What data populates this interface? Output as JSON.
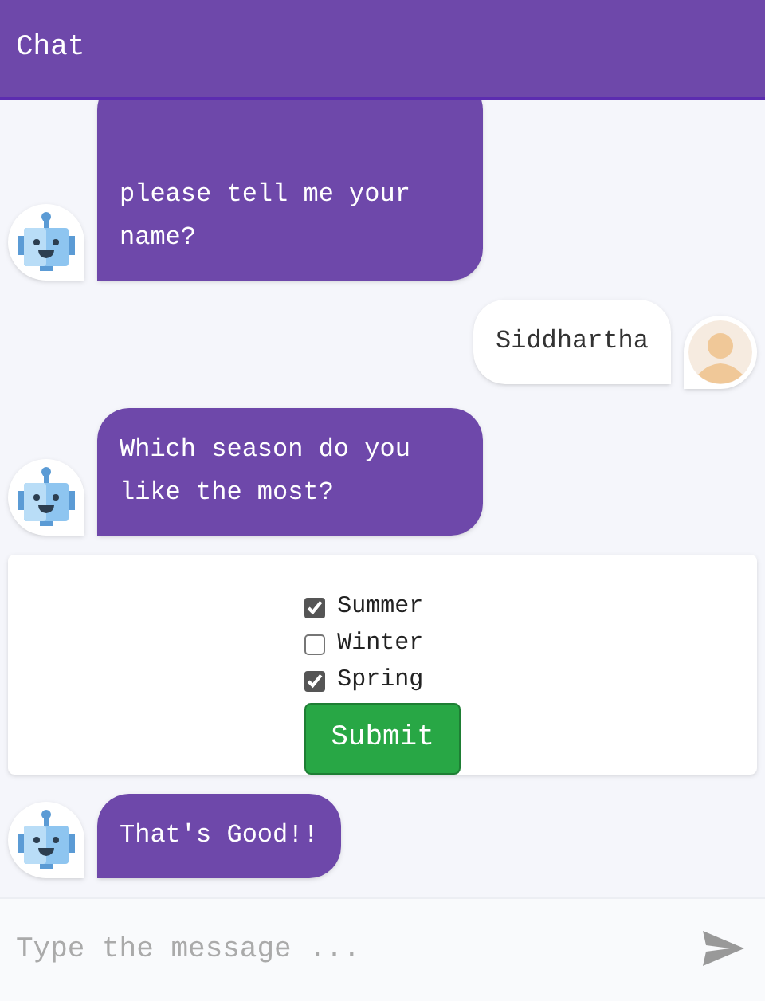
{
  "header": {
    "title": "Chat"
  },
  "messages": [
    {
      "kind": "bot",
      "text": "please tell me your name?"
    },
    {
      "kind": "user",
      "text": "Siddhartha"
    },
    {
      "kind": "bot",
      "text": "Which season do you like the most?"
    },
    {
      "kind": "form",
      "options": [
        {
          "label": "Summer",
          "checked": true
        },
        {
          "label": "Winter",
          "checked": false
        },
        {
          "label": "Spring",
          "checked": true
        }
      ],
      "button": "Submit"
    },
    {
      "kind": "bot",
      "text": "That's Good!!"
    }
  ],
  "composer": {
    "placeholder": "Type the message ..."
  }
}
